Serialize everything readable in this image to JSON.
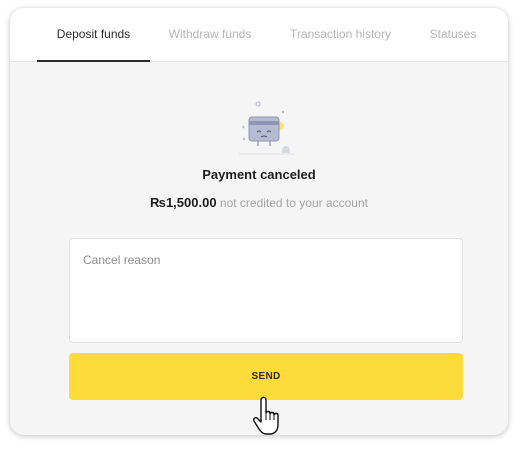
{
  "tabs": [
    {
      "label": "Deposit funds",
      "active": true
    },
    {
      "label": "Withdraw funds",
      "active": false
    },
    {
      "label": "Transaction history",
      "active": false
    },
    {
      "label": "Statuses",
      "active": false
    }
  ],
  "status": {
    "icon": "sad-credit-card-icon",
    "title": "Payment canceled",
    "amount": "₨1,500.00",
    "note": "not credited to your account"
  },
  "form": {
    "reason_placeholder": "Cancel reason",
    "reason_value": "",
    "send_label": "SEND"
  },
  "colors": {
    "accent": "#fddb3a",
    "background": "#f5f5f5",
    "active_tab": "#2b2b2b",
    "inactive_tab": "#b4b4b4"
  },
  "cursor": "hand-pointer-icon"
}
